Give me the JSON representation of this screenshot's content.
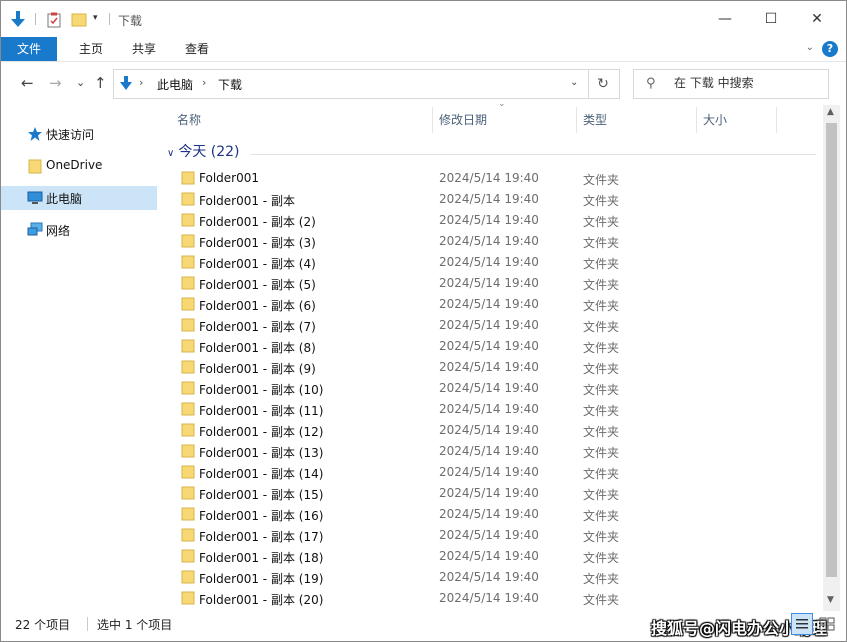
{
  "window": {
    "title": "下载",
    "controls": {
      "minimize": "—",
      "maximize": "☐",
      "close": "✕"
    }
  },
  "quick_access_toolbar": {
    "icons": [
      "download-arrow-icon",
      "properties-icon",
      "new-folder-icon",
      "customize-dropdown-icon"
    ],
    "dropdown_glyph": "▾"
  },
  "ribbon": {
    "tabs": [
      "文件",
      "主页",
      "共享",
      "查看"
    ],
    "collapse_glyph": "⌄",
    "help_glyph": "?"
  },
  "navigation": {
    "back": "←",
    "forward": "→",
    "recent": "⌄",
    "up": "↑",
    "breadcrumb": [
      "此电脑",
      "下载"
    ],
    "separator": "›",
    "address_dropdown": "⌄",
    "refresh": "↻",
    "search_placeholder": "在 下载 中搜索",
    "search_glyph": "⚲"
  },
  "sidebar": {
    "items": [
      {
        "label": "快速访问",
        "icon": "star-icon",
        "selected": false
      },
      {
        "label": "OneDrive",
        "icon": "folder-icon",
        "selected": false
      },
      {
        "label": "此电脑",
        "icon": "computer-icon",
        "selected": true
      },
      {
        "label": "网络",
        "icon": "network-icon",
        "selected": false
      }
    ]
  },
  "columns": [
    "名称",
    "修改日期",
    "类型",
    "大小"
  ],
  "sort_glyph": "⌄",
  "group": {
    "chevron": "∨",
    "label": "今天 (22)"
  },
  "files": [
    {
      "name": "Folder001",
      "date": "2024/5/14 19:40",
      "type": "文件夹"
    },
    {
      "name": "Folder001 - 副本",
      "date": "2024/5/14 19:40",
      "type": "文件夹"
    },
    {
      "name": "Folder001 - 副本 (2)",
      "date": "2024/5/14 19:40",
      "type": "文件夹"
    },
    {
      "name": "Folder001 - 副本 (3)",
      "date": "2024/5/14 19:40",
      "type": "文件夹"
    },
    {
      "name": "Folder001 - 副本 (4)",
      "date": "2024/5/14 19:40",
      "type": "文件夹"
    },
    {
      "name": "Folder001 - 副本 (5)",
      "date": "2024/5/14 19:40",
      "type": "文件夹"
    },
    {
      "name": "Folder001 - 副本 (6)",
      "date": "2024/5/14 19:40",
      "type": "文件夹"
    },
    {
      "name": "Folder001 - 副本 (7)",
      "date": "2024/5/14 19:40",
      "type": "文件夹"
    },
    {
      "name": "Folder001 - 副本 (8)",
      "date": "2024/5/14 19:40",
      "type": "文件夹"
    },
    {
      "name": "Folder001 - 副本 (9)",
      "date": "2024/5/14 19:40",
      "type": "文件夹"
    },
    {
      "name": "Folder001 - 副本 (10)",
      "date": "2024/5/14 19:40",
      "type": "文件夹"
    },
    {
      "name": "Folder001 - 副本 (11)",
      "date": "2024/5/14 19:40",
      "type": "文件夹"
    },
    {
      "name": "Folder001 - 副本 (12)",
      "date": "2024/5/14 19:40",
      "type": "文件夹"
    },
    {
      "name": "Folder001 - 副本 (13)",
      "date": "2024/5/14 19:40",
      "type": "文件夹"
    },
    {
      "name": "Folder001 - 副本 (14)",
      "date": "2024/5/14 19:40",
      "type": "文件夹"
    },
    {
      "name": "Folder001 - 副本 (15)",
      "date": "2024/5/14 19:40",
      "type": "文件夹"
    },
    {
      "name": "Folder001 - 副本 (16)",
      "date": "2024/5/14 19:40",
      "type": "文件夹"
    },
    {
      "name": "Folder001 - 副本 (17)",
      "date": "2024/5/14 19:40",
      "type": "文件夹"
    },
    {
      "name": "Folder001 - 副本 (18)",
      "date": "2024/5/14 19:40",
      "type": "文件夹"
    },
    {
      "name": "Folder001 - 副本 (19)",
      "date": "2024/5/14 19:40",
      "type": "文件夹"
    },
    {
      "name": "Folder001 - 副本 (20)",
      "date": "2024/5/14 19:40",
      "type": "文件夹"
    }
  ],
  "scrollbar": {
    "up": "▲",
    "down": "▼"
  },
  "status": {
    "item_count": "22 个项目",
    "selected": "选中 1 个项目",
    "watermark": "搜狐号@闪电办公小助理"
  },
  "colors": {
    "accent": "#1979ca",
    "selection": "#cce4f7",
    "folder": "#f8d775",
    "group_text": "#1e3287"
  }
}
